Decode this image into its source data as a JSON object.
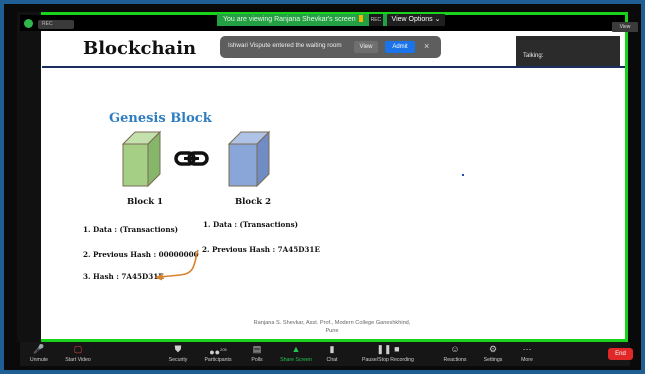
{
  "app": {
    "viewing_banner": "You are viewing Ranjana Shevkar's screen",
    "rec_tag": "REC",
    "view_options": "View Options ⌄",
    "view_button": "View",
    "top_rec_indicator": "REC"
  },
  "notification": {
    "text": "Ishwari Vispute entered the waiting room",
    "view_label": "View",
    "admit_label": "Admit",
    "close_label": "×"
  },
  "talking": {
    "label": "Talking:"
  },
  "slide": {
    "title": "Blockchain",
    "subtitle": "Genesis Block",
    "block1": {
      "label": "Block 1",
      "data": "1.  Data : (Transactions)",
      "prev_hash": "2. Previous Hash : 00000000",
      "hash": "3. Hash : 7A45D31E"
    },
    "block2": {
      "label": "Block 2",
      "data": "1.  Data : (Transactions)",
      "prev_hash": "2. Previous Hash : 7A45D31E"
    },
    "credit_line1": "Ranjana S. Shevkar, Asst. Prof., Modern College Ganeshkhind,",
    "credit_line2": "Pune"
  },
  "toolbar": {
    "unmute": "Unmute",
    "start_video": "Start Video",
    "security": "Security",
    "participants": "Participants",
    "participants_count": "205",
    "polls": "Polls",
    "share_screen": "Share Screen",
    "chat": "Chat",
    "pause_stop_recording": "Pause/Stop Recording",
    "reactions": "Reactions",
    "settings": "Settings",
    "more": "More",
    "end": "End"
  },
  "colors": {
    "sharing_green": "#19d21a",
    "outer_blue": "#1f5f93",
    "admit_blue": "#1a73e8",
    "end_red": "#e02828",
    "block1_green": "#a6cf86",
    "block2_blue": "#8aa6d8",
    "arrow_orange": "#d9822b"
  },
  "icons": {
    "shield": "shield-icon",
    "mic": "mic-muted-icon",
    "video": "video-off-icon",
    "security": "shield-icon",
    "participants": "people-icon",
    "polls": "bar-chart-icon",
    "share": "share-screen-icon",
    "chat": "chat-bubble-icon",
    "record": "pause-stop-icon",
    "reactions": "emoji-icon",
    "settings": "gear-icon",
    "more": "ellipsis-icon",
    "chain": "chain-link-icon"
  }
}
